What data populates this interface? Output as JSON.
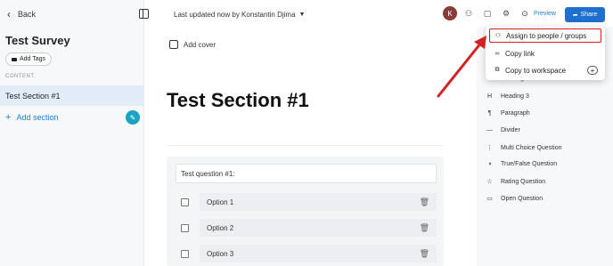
{
  "sidebar": {
    "back_label": "Back",
    "survey_title": "Test Survey",
    "add_tags_label": "Add Tags",
    "content_label": "CONTENT",
    "section_item": "Test Section #1",
    "add_section_label": "Add section"
  },
  "topbar": {
    "updated_text": "Last updated now by Konstantin Djima",
    "avatar_initial": "K",
    "preview_label": "Preview",
    "share_label": "Share"
  },
  "main": {
    "add_cover_label": "Add cover",
    "section_heading": "Test Section #1",
    "question_title": "Test question #1:",
    "options": [
      "Option 1",
      "Option 2",
      "Option 3"
    ]
  },
  "right_panel": {
    "items": [
      {
        "icon": "H",
        "label": "Heading 2"
      },
      {
        "icon": "H",
        "label": "Heading 3"
      },
      {
        "icon": "¶",
        "label": "Paragraph"
      },
      {
        "icon": "—",
        "label": "Divider"
      },
      {
        "icon": "⋮",
        "label": "Multi Choice Question"
      },
      {
        "icon": "◑",
        "label": "True/False Question"
      },
      {
        "icon": "☆",
        "label": "Rating Question"
      },
      {
        "icon": "▭",
        "label": "Open Question"
      }
    ]
  },
  "dropdown": {
    "items": [
      {
        "icon": "👥",
        "label": "Assign to people / groups"
      },
      {
        "icon": "⛓",
        "label": "Copy link"
      },
      {
        "icon": "⧉",
        "label": "Copy to workspace"
      }
    ],
    "plus_label": "+"
  },
  "colors": {
    "accent_blue": "#1a7fd8",
    "share_bg": "#1f6fd1",
    "highlight_red": "#d61f1f",
    "avatar_bg": "#8b3a3a"
  }
}
